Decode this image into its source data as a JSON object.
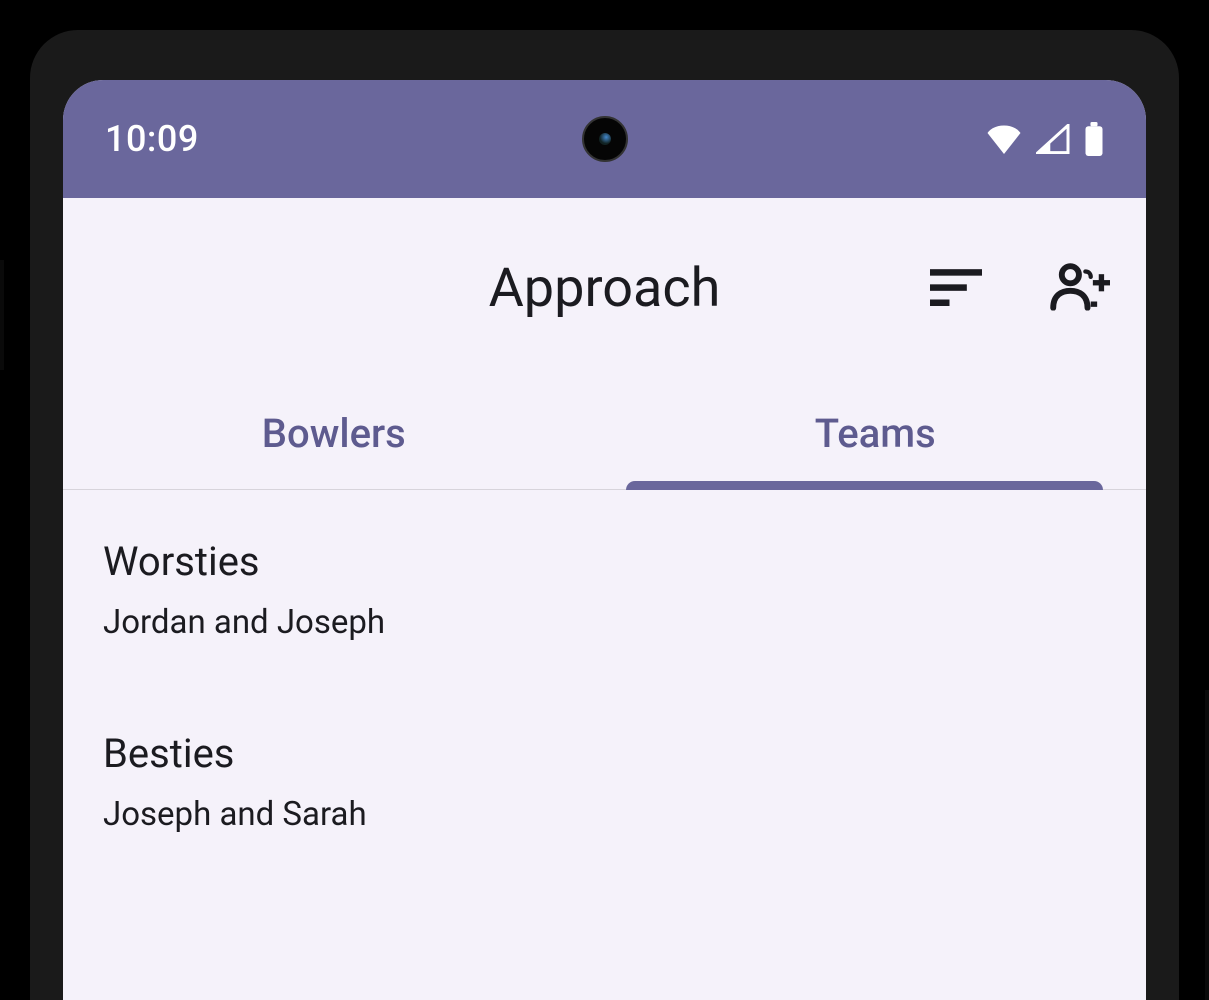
{
  "status_bar": {
    "time": "10:09"
  },
  "app_bar": {
    "title": "Approach"
  },
  "tabs": [
    {
      "label": "Bowlers",
      "active": false
    },
    {
      "label": "Teams",
      "active": true
    }
  ],
  "teams": [
    {
      "name": "Worsties",
      "members": "Jordan and Joseph"
    },
    {
      "name": "Besties",
      "members": "Joseph and Sarah"
    }
  ]
}
